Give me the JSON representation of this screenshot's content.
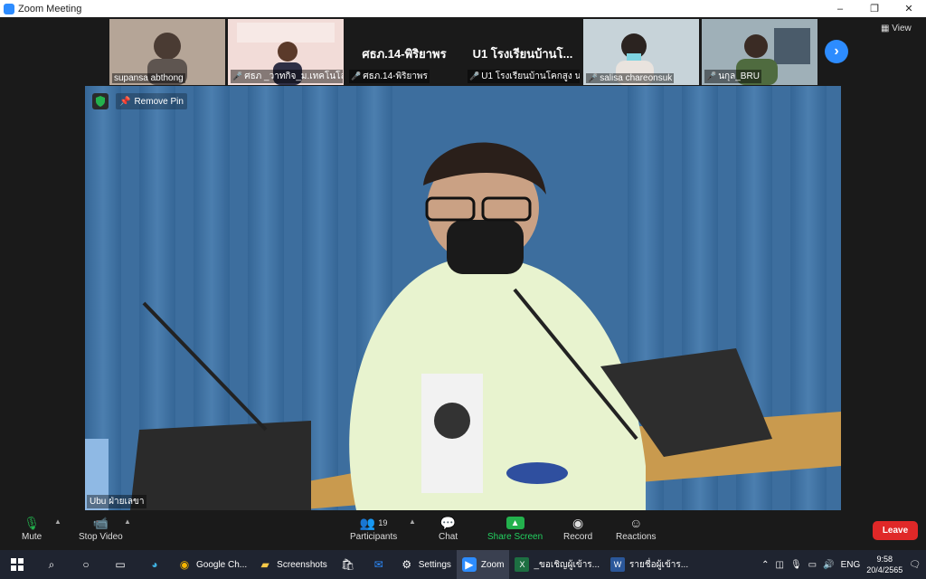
{
  "window": {
    "title": "Zoom Meeting",
    "controls": [
      "–",
      "❐",
      "✕"
    ]
  },
  "gallery": {
    "tiles": [
      {
        "name": "supansa abthong",
        "big": "",
        "muted": false,
        "bg": "#9e8e82"
      },
      {
        "name": "ศธภ _วาทกิจ_ม.เทคโนโลยี...",
        "big": "",
        "muted": true,
        "bg": "#d9a7a4"
      },
      {
        "name": "ศธภ.14-พิริยาพร",
        "big": "ศธภ.14-พิริยาพร",
        "muted": true,
        "bg": "#1a1a1a"
      },
      {
        "name": "U1 โรงเรียนบ้านโคกสูง น...",
        "big": "U1 โรงเรียนบ้านโ...",
        "muted": true,
        "bg": "#1a1a1a"
      },
      {
        "name": "salisa chareonsuk",
        "big": "",
        "muted": true,
        "bg": "#8ea3ad"
      },
      {
        "name": "นกุล_BRU",
        "big": "",
        "muted": true,
        "bg": "#7b8f77"
      }
    ],
    "next_label": "›",
    "view_label": "View"
  },
  "main_video": {
    "remove_pin_label": "Remove Pin",
    "speaker_name": "Ubu ฝ่ายเลขา"
  },
  "toolbar": {
    "mute": "Mute",
    "stop_video": "Stop Video",
    "participants": "Participants",
    "participants_count": "19",
    "chat": "Chat",
    "share_screen": "Share Screen",
    "record": "Record",
    "reactions": "Reactions",
    "leave": "Leave"
  },
  "taskbar": {
    "apps": [
      {
        "label": "Google Ch...",
        "icon": "chrome-icon",
        "active": false
      },
      {
        "label": "Screenshots",
        "icon": "folder-icon",
        "active": false
      },
      {
        "label": "Settings",
        "icon": "gear-icon",
        "active": false
      },
      {
        "label": "Zoom",
        "icon": "zoom-icon",
        "active": true
      },
      {
        "label": "_ขอเชิญผู้เข้าร...",
        "icon": "excel-icon",
        "active": false
      },
      {
        "label": "รายชื่อผู้เข้าร...",
        "icon": "word-icon",
        "active": false
      }
    ],
    "tray": {
      "language": "ENG",
      "time": "9:58",
      "date": "20/4/2565"
    }
  },
  "colors": {
    "accent": "#2d8cff",
    "leave": "#e02828",
    "share": "#23b14d",
    "muted_mic": "#e0383e"
  }
}
